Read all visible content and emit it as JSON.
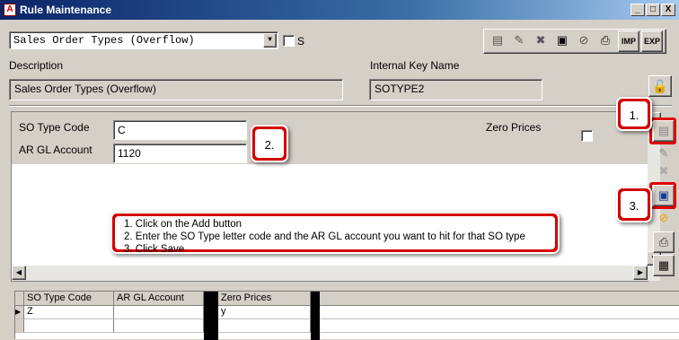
{
  "window": {
    "title": "Rule Maintenance",
    "app_icon": "A",
    "minimize": "_",
    "maximize": "□",
    "close": "X"
  },
  "selector": {
    "value": "Sales Order Types (Overflow)",
    "s_label": "S"
  },
  "toolbar": {
    "imp_label": "IMP",
    "exp_label": "EXP",
    "icons": [
      "add-icon",
      "edit-icon",
      "delete-icon",
      "save-icon",
      "cancel-icon",
      "print-icon"
    ]
  },
  "header": {
    "description_label": "Description",
    "description_value": "Sales Order Types (Overflow)",
    "internal_key_label": "Internal Key Name",
    "internal_key_value": "SOTYPE2"
  },
  "form": {
    "so_type_code_label": "SO Type Code",
    "so_type_code_value": "C",
    "ar_gl_account_label": "AR GL Account",
    "ar_gl_account_value": "1120",
    "zero_prices_label": "Zero Prices"
  },
  "callouts": {
    "step1": "1.",
    "step2": "2.",
    "step3": "3.",
    "instructions": [
      "1. Click on the Add button",
      "2. Enter the SO Type letter code and the AR GL account you want to hit for that SO type",
      "3. Click Save"
    ]
  },
  "grid": {
    "columns": [
      "SO Type Code",
      "AR GL Account",
      "Zero Prices"
    ],
    "rows": [
      {
        "so_type_code": "Z",
        "ar_gl_account": "",
        "zero_prices": "y"
      }
    ]
  },
  "colors": {
    "callout_red": "#d40000",
    "titlebar_blue": "#0a246a"
  }
}
